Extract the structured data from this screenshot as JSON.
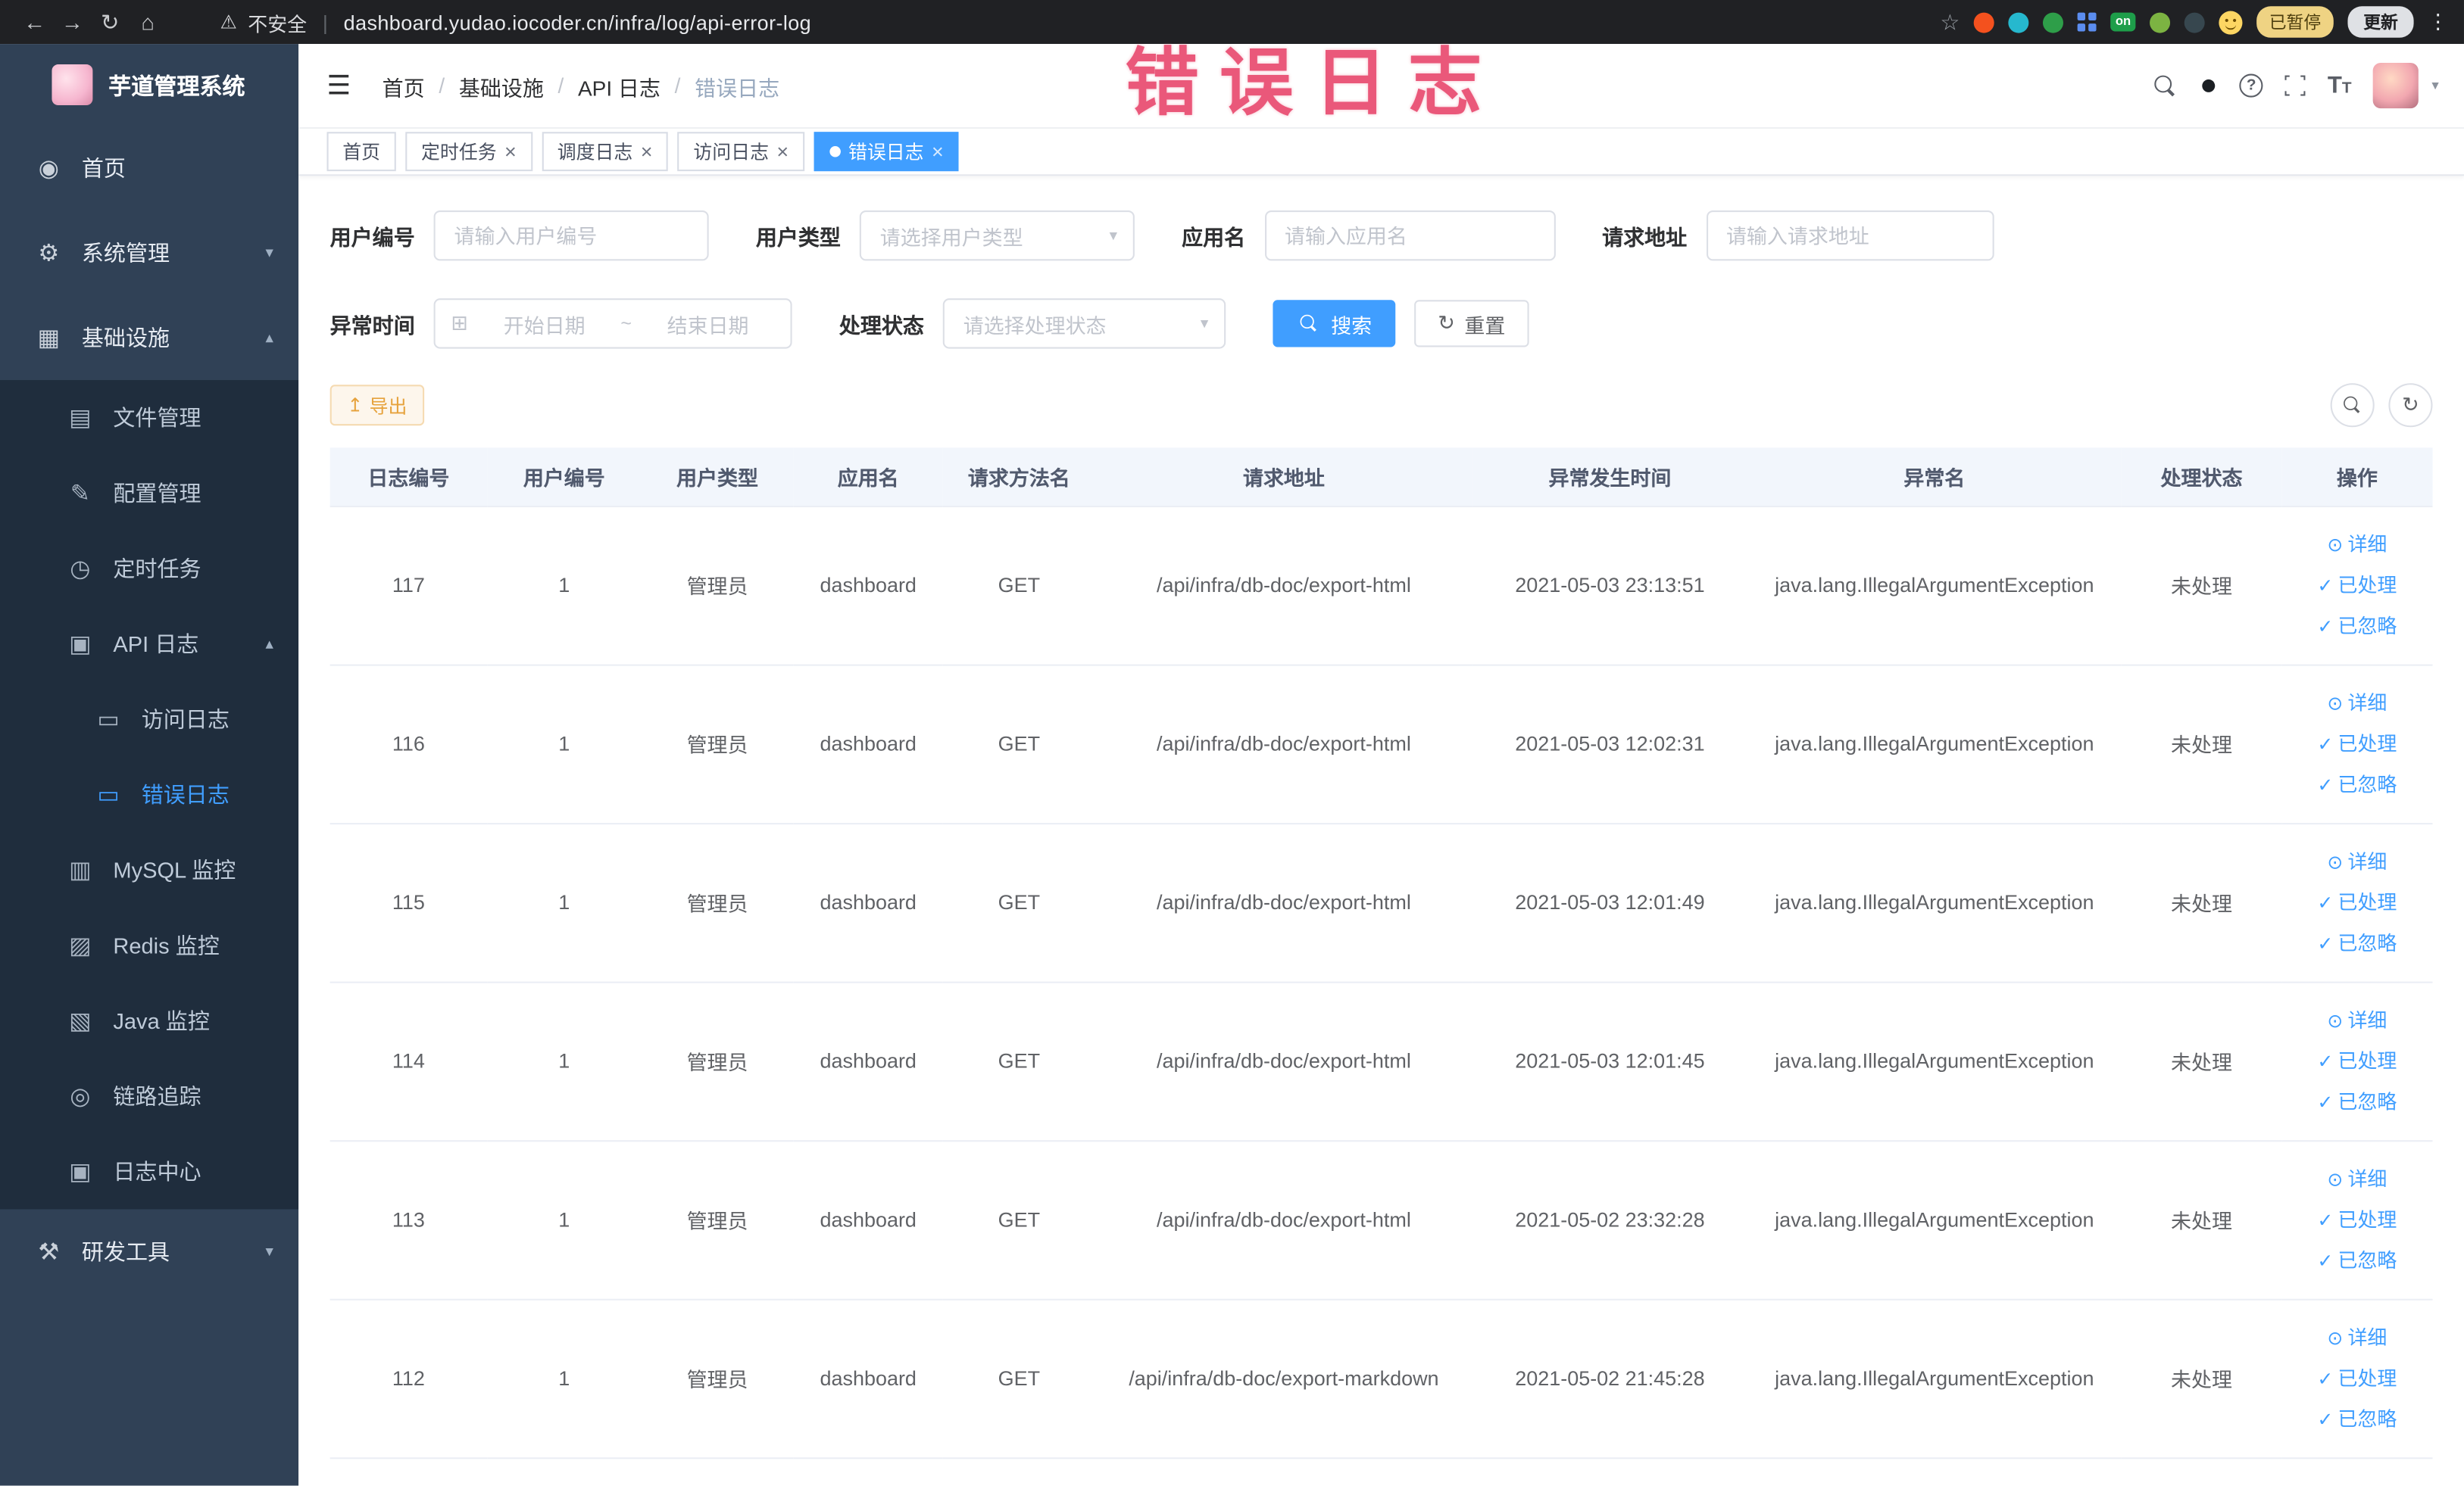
{
  "browser": {
    "security_label": "不安全",
    "url": "dashboard.yudao.iocoder.cn/infra/log/api-error-log",
    "paused_badge": "已暂停",
    "update_button": "更新",
    "extension_on_label": "on"
  },
  "annotation": {
    "text": "错误日志"
  },
  "icons": {
    "back": "←",
    "forward": "→",
    "reload": "↻",
    "home": "⌂",
    "warning": "⚠",
    "star": "☆",
    "more": "⋮",
    "menu": "☰",
    "caret_down": "▾",
    "caret_up": "▴",
    "close": "×",
    "calendar": "⊞",
    "export": "↥",
    "refresh": "↻",
    "eye": "⊙",
    "check": "✓",
    "github": "●",
    "help": "?",
    "font_size_large": "T",
    "font_size_small": "T",
    "home_menu": "◉",
    "system": "⚙",
    "infra": "▦",
    "file": "▤",
    "config": "✎",
    "cron": "◷",
    "api_log": "▣",
    "doc": "▭",
    "mysql": "▥",
    "redis": "▨",
    "java": "▧",
    "trace": "◎",
    "log_center": "▣",
    "dev_tools": "⚒"
  },
  "sidebar": {
    "logo_title": "芋道管理系统",
    "items": [
      {
        "label": "首页"
      },
      {
        "label": "系统管理"
      },
      {
        "label": "基础设施"
      },
      {
        "label": "文件管理"
      },
      {
        "label": "配置管理"
      },
      {
        "label": "定时任务"
      },
      {
        "label": "API 日志"
      },
      {
        "label": "访问日志"
      },
      {
        "label": "错误日志"
      },
      {
        "label": "MySQL 监控"
      },
      {
        "label": "Redis 监控"
      },
      {
        "label": "Java 监控"
      },
      {
        "label": "链路追踪"
      },
      {
        "label": "日志中心"
      },
      {
        "label": "研发工具"
      }
    ]
  },
  "breadcrumb": {
    "items": [
      "首页",
      "基础设施",
      "API 日志",
      "错误日志"
    ],
    "separator": "/"
  },
  "tabs": [
    {
      "label": "首页"
    },
    {
      "label": "定时任务"
    },
    {
      "label": "调度日志"
    },
    {
      "label": "访问日志"
    },
    {
      "label": "错误日志"
    }
  ],
  "filters": {
    "user_id": {
      "label": "用户编号",
      "placeholder": "请输入用户编号"
    },
    "user_type": {
      "label": "用户类型",
      "placeholder": "请选择用户类型"
    },
    "app_name": {
      "label": "应用名",
      "placeholder": "请输入应用名"
    },
    "request_url": {
      "label": "请求地址",
      "placeholder": "请输入请求地址"
    },
    "exception_time": {
      "label": "异常时间",
      "start_placeholder": "开始日期",
      "separator": "~",
      "end_placeholder": "结束日期"
    },
    "process_status": {
      "label": "处理状态",
      "placeholder": "请选择处理状态"
    },
    "search_button": "搜索",
    "reset_button": "重置"
  },
  "toolbar": {
    "export_button": "导出"
  },
  "table": {
    "headers": [
      "日志编号",
      "用户编号",
      "用户类型",
      "应用名",
      "请求方法名",
      "请求地址",
      "异常发生时间",
      "异常名",
      "处理状态",
      "操作"
    ],
    "actions": {
      "detail": "详细",
      "processed": "已处理",
      "ignored": "已忽略"
    },
    "rows": [
      {
        "log_id": "117",
        "user_id": "1",
        "user_type": "管理员",
        "app_name": "dashboard",
        "method": "GET",
        "url": "/api/infra/db-doc/export-html",
        "time": "2021-05-03 23:13:51",
        "exception": "java.lang.IllegalArgumentException",
        "status": "未处理"
      },
      {
        "log_id": "116",
        "user_id": "1",
        "user_type": "管理员",
        "app_name": "dashboard",
        "method": "GET",
        "url": "/api/infra/db-doc/export-html",
        "time": "2021-05-03 12:02:31",
        "exception": "java.lang.IllegalArgumentException",
        "status": "未处理"
      },
      {
        "log_id": "115",
        "user_id": "1",
        "user_type": "管理员",
        "app_name": "dashboard",
        "method": "GET",
        "url": "/api/infra/db-doc/export-html",
        "time": "2021-05-03 12:01:49",
        "exception": "java.lang.IllegalArgumentException",
        "status": "未处理"
      },
      {
        "log_id": "114",
        "user_id": "1",
        "user_type": "管理员",
        "app_name": "dashboard",
        "method": "GET",
        "url": "/api/infra/db-doc/export-html",
        "time": "2021-05-03 12:01:45",
        "exception": "java.lang.IllegalArgumentException",
        "status": "未处理"
      },
      {
        "log_id": "113",
        "user_id": "1",
        "user_type": "管理员",
        "app_name": "dashboard",
        "method": "GET",
        "url": "/api/infra/db-doc/export-html",
        "time": "2021-05-02 23:32:28",
        "exception": "java.lang.IllegalArgumentException",
        "status": "未处理"
      },
      {
        "log_id": "112",
        "user_id": "1",
        "user_type": "管理员",
        "app_name": "dashboard",
        "method": "GET",
        "url": "/api/infra/db-doc/export-markdown",
        "time": "2021-05-02 21:45:28",
        "exception": "java.lang.IllegalArgumentException",
        "status": "未处理"
      }
    ]
  }
}
